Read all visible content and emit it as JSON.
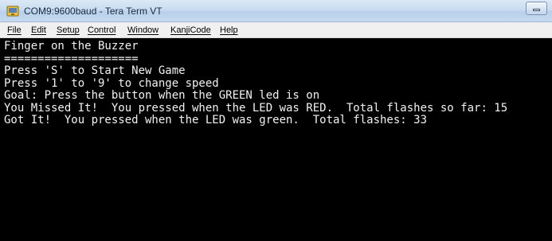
{
  "window": {
    "title": "COM9:9600baud - Tera Term VT",
    "icon": "tera-term-app-icon"
  },
  "menu": {
    "items": [
      "File",
      "Edit",
      "Setup",
      "Control",
      "Window",
      "KanjiCode",
      "Help"
    ]
  },
  "terminal": {
    "lines": [
      "Finger on the Buzzer",
      "====================",
      "Press 'S' to Start New Game",
      "Press '1' to '9' to change speed",
      "Goal: Press the button when the GREEN led is on",
      "You Missed It!  You pressed when the LED was RED.  Total flashes so far: 15",
      "Got It!  You pressed when the LED was green.  Total flashes: 33"
    ]
  },
  "colors": {
    "terminal_background": "#000000",
    "terminal_text": "#f2f2f2",
    "titlebar": "#c9dcf1",
    "menubar": "#f0f0f0"
  }
}
